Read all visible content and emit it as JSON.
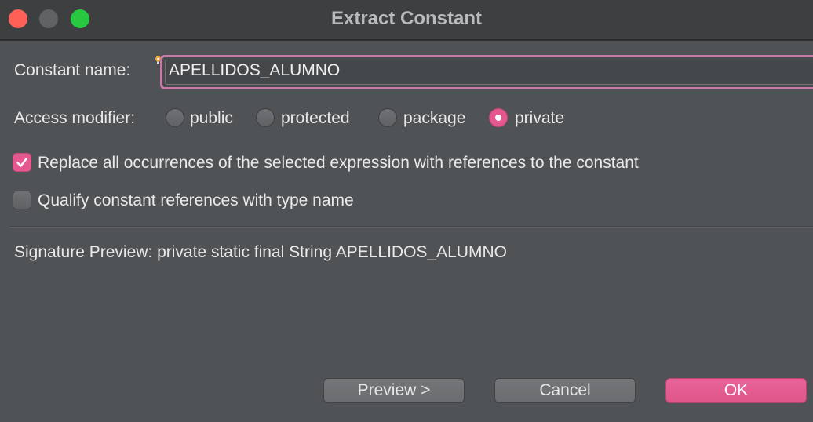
{
  "window": {
    "title": "Extract Constant"
  },
  "form": {
    "constant_name_label": "Constant name:",
    "constant_name_value": "APELLIDOS_ALUMNO",
    "access_modifier_label": "Access modifier:",
    "access_modifiers": [
      {
        "label": "public",
        "selected": false
      },
      {
        "label": "protected",
        "selected": false
      },
      {
        "label": "package",
        "selected": false
      },
      {
        "label": "private",
        "selected": true
      }
    ],
    "replace_all_label": "Replace all occurrences of the selected expression with references to the constant",
    "replace_all_checked": true,
    "qualify_label": "Qualify constant references with type name",
    "qualify_checked": false,
    "signature_preview": "Signature Preview: private static final String APELLIDOS_ALUMNO"
  },
  "buttons": {
    "preview_label": "Preview >",
    "cancel_label": "Cancel",
    "ok_label": "OK"
  },
  "colors": {
    "accent": "#e4578f",
    "focus_ring": "#c87aa6",
    "background": "#505356",
    "titlebar": "#3e3f41"
  }
}
